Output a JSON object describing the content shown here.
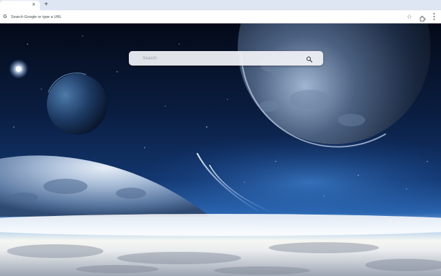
{
  "browser": {
    "tab_close": "×",
    "new_tab": "+",
    "omnibox_placeholder": "Search Google or type a URL",
    "omnibox_g": "G",
    "bookmark_star": "☆"
  },
  "newtab": {
    "search_placeholder": "Search"
  },
  "colors": {
    "tabstrip": "#dfe6f3",
    "sky_top": "#040a18",
    "sky_mid": "#0b2450",
    "horizon_glow": "#f3f4f0"
  },
  "icons": {
    "search": "search-icon",
    "star": "star-icon",
    "extensions": "puzzle-icon",
    "menu": "kebab-menu-icon"
  }
}
